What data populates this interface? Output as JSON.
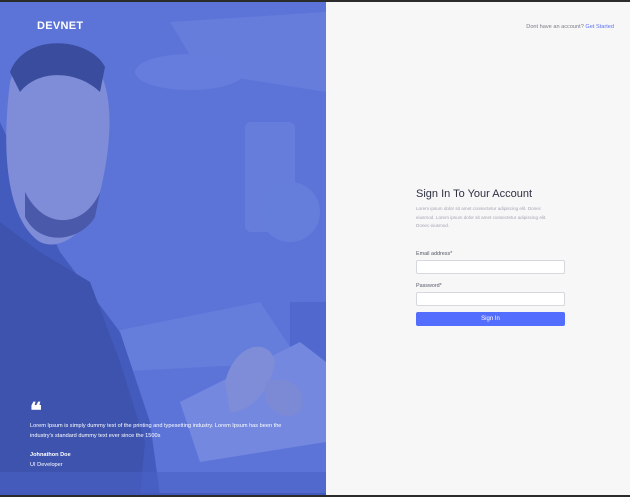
{
  "brand": {
    "name": "DEVNET"
  },
  "testimonial": {
    "quote_icon": "❝",
    "text": "Lorem Ipsum is simply dummy text of the printing and typesetting industry. Lorem Ipsum has been the industry's standard dummy text ever since the 1500s",
    "author_name": "Johnathon Doe",
    "author_role": "UI Developer"
  },
  "header": {
    "signup_prompt": "Dont have an account?",
    "signup_link": "Get Started"
  },
  "form": {
    "title": "Sign In To Your Account",
    "description": "Lorem ipsum dolor sit amet consectetur adipiscing elit. Donec eiusmod. Lorem ipsum dolor sit amet consectetur adipiscing elit. Donec eiusmod.",
    "email_label": "Email address*",
    "email_value": "",
    "password_label": "Password*",
    "password_value": "",
    "submit_label": "Sign In"
  },
  "colors": {
    "hero_overlay": "#5b72d6",
    "accent": "#536dfe",
    "link": "#5b72f0"
  }
}
